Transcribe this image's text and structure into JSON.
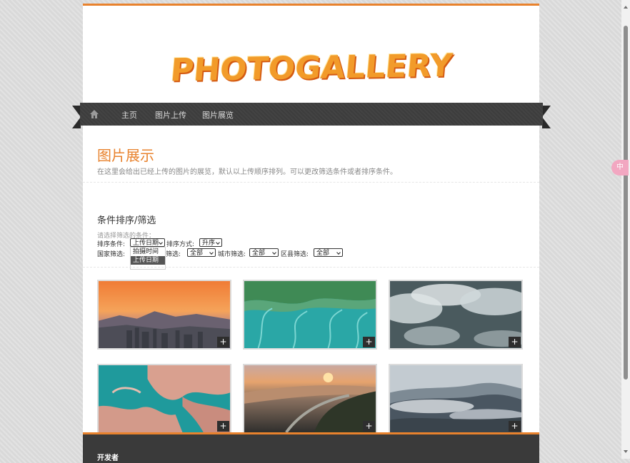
{
  "logo": {
    "text": "PHOTOGALLERY"
  },
  "nav": {
    "items": [
      {
        "label": "主页"
      },
      {
        "label": "图片上传"
      },
      {
        "label": "图片展览"
      }
    ]
  },
  "side_bubble": {
    "text": "中"
  },
  "header": {
    "title": "图片展示",
    "description": "在这里会给出已经上传的图片的展览，默认以上传顺序排列。可以更改筛选条件或者排序条件。"
  },
  "filter": {
    "title": "条件排序/筛选",
    "hint": "请选择筛选的条件：",
    "sort_field_label": "排序条件:",
    "sort_field_value": "上传日期",
    "sort_order_label": "排序方式:",
    "sort_order_value": "升序",
    "country_label": "国家筛选:",
    "province_label_tail": "筛选:",
    "province_value": "全部",
    "city_label": "城市筛选:",
    "city_value": "全部",
    "district_label": "区县筛选:",
    "district_value": "全部",
    "dropdown_options": [
      "拍摄时间",
      "上传日期"
    ]
  },
  "gallery": {
    "plus_symbol": "+",
    "photos": [
      {
        "name": "sunset-city-mountains"
      },
      {
        "name": "aerial-tidal-flats-green"
      },
      {
        "name": "aerial-clouds-mountains"
      },
      {
        "name": "aerial-island-coral"
      },
      {
        "name": "aerial-beach-sunrise"
      },
      {
        "name": "foggy-mountains"
      }
    ]
  },
  "footer": {
    "title": "开发者"
  }
}
